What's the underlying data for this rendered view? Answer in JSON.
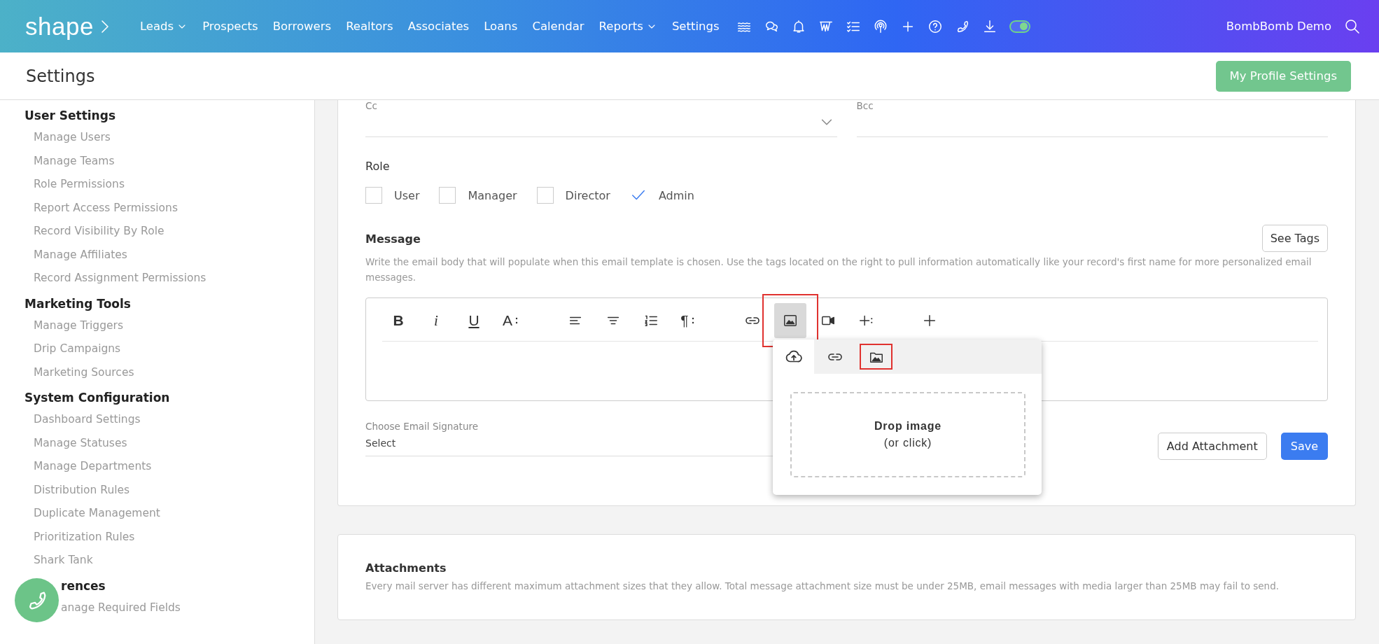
{
  "topbar": {
    "logo": "shape",
    "nav": [
      {
        "label": "Leads",
        "has_menu": true
      },
      {
        "label": "Prospects",
        "has_menu": false
      },
      {
        "label": "Borrowers",
        "has_menu": false
      },
      {
        "label": "Realtors",
        "has_menu": false
      },
      {
        "label": "Associates",
        "has_menu": false
      },
      {
        "label": "Loans",
        "has_menu": false
      },
      {
        "label": "Calendar",
        "has_menu": false
      },
      {
        "label": "Reports",
        "has_menu": true
      },
      {
        "label": "Settings",
        "has_menu": false
      }
    ],
    "tools": [
      {
        "kind": "waves"
      },
      {
        "kind": "chat"
      },
      {
        "kind": "bell"
      },
      {
        "kind": "brand"
      },
      {
        "kind": "checklist"
      },
      {
        "kind": "podcast"
      },
      {
        "kind": "plus"
      },
      {
        "kind": "help"
      },
      {
        "kind": "phone"
      },
      {
        "kind": "download"
      },
      {
        "kind": "toggle",
        "on": true
      }
    ],
    "user": "BombBomb Demo"
  },
  "header": {
    "title": "Settings",
    "button": "My Profile Settings"
  },
  "sidebar": {
    "sections": [
      {
        "title": "User Settings",
        "items": [
          "Manage Users",
          "Manage Teams",
          "Role Permissions",
          "Report Access Permissions",
          "Record Visibility By Role",
          "Manage Affiliates",
          "Record Assignment Permissions"
        ]
      },
      {
        "title": "Marketing Tools",
        "items": [
          "Manage Triggers",
          "Drip Campaigns",
          "Marketing Sources"
        ]
      },
      {
        "title": "System Configuration",
        "items": [
          "Dashboard Settings",
          "Manage Statuses",
          "Manage Departments",
          "Distribution Rules",
          "Duplicate Management",
          "Prioritization Rules",
          "Shark Tank"
        ]
      },
      {
        "title": "rences",
        "items": [
          "anage Required Fields"
        ]
      }
    ]
  },
  "form": {
    "cc": {
      "label": "Cc"
    },
    "bcc": {
      "label": "Bcc"
    },
    "role": {
      "label": "Role",
      "options": [
        {
          "label": "User",
          "checked": false
        },
        {
          "label": "Manager",
          "checked": false
        },
        {
          "label": "Director",
          "checked": false
        },
        {
          "label": "Admin",
          "checked": true
        }
      ]
    },
    "message": {
      "title": "Message",
      "see_tags": "See Tags",
      "description": "Write the email body that will populate when this email template is chosen. Use the tags located on the right to pull information automatically like your record's first name for more personalized email messages.",
      "toolbar": [
        [
          {
            "kind": "bold",
            "label": "B",
            "highlighted": false
          },
          {
            "kind": "italic",
            "label": "i",
            "highlighted": false
          },
          {
            "kind": "underline",
            "label": "U",
            "highlighted": false
          },
          {
            "kind": "font-size",
            "label": "A",
            "highlighted": false
          }
        ],
        [
          {
            "kind": "align-left",
            "highlighted": false
          },
          {
            "kind": "align-center",
            "highlighted": false
          },
          {
            "kind": "ordered-list",
            "highlighted": false
          },
          {
            "kind": "paragraph",
            "label": "¶",
            "highlighted": false
          }
        ],
        [
          {
            "kind": "link",
            "highlighted": false
          },
          {
            "kind": "image",
            "highlighted": true
          },
          {
            "kind": "video",
            "highlighted": false
          },
          {
            "kind": "insert",
            "highlighted": false
          }
        ],
        [
          {
            "kind": "add",
            "highlighted": false
          }
        ]
      ],
      "image_popup": {
        "tabs": [
          {
            "kind": "upload",
            "selected": true,
            "highlighted": false
          },
          {
            "kind": "link",
            "selected": false,
            "highlighted": false
          },
          {
            "kind": "gallery",
            "selected": false,
            "highlighted": true
          }
        ],
        "drop_title": "Drop image",
        "drop_hint": "(or click)"
      }
    },
    "signature": {
      "label": "Choose Email Signature",
      "value": "Select"
    },
    "add_attachment": "Add Attachment",
    "save": "Save"
  },
  "attachments": {
    "title": "Attachments",
    "description": "Every mail server has different maximum attachment sizes that they allow. Total message attachment size must be under 25MB, email messages with media larger than 25MB may fail to send."
  }
}
